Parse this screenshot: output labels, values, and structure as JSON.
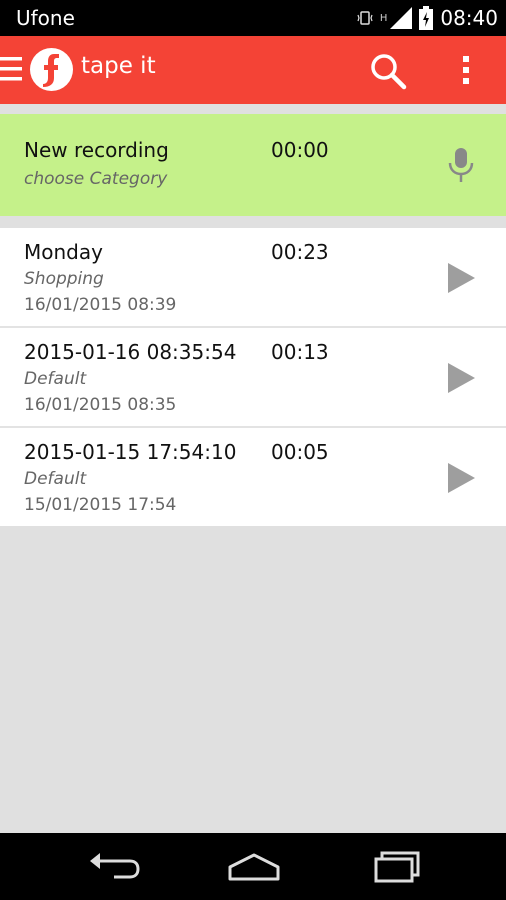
{
  "status_bar": {
    "carrier": "Ufone",
    "network_type": "H",
    "time": "08:40"
  },
  "app_bar": {
    "title": "tape it",
    "background_color": "#f44336",
    "icons": [
      "menu-icon",
      "tape-it-logo",
      "search-icon",
      "overflow-menu-icon"
    ]
  },
  "new_recording": {
    "title": "New recording",
    "duration": "00:00",
    "category": "choose Category",
    "background_color": "#c5f18a",
    "icon": "microphone-icon"
  },
  "recordings": [
    {
      "title": "Monday",
      "duration": "00:23",
      "category": "Shopping",
      "date": "16/01/2015 08:39"
    },
    {
      "title": "2015-01-16 08:35:54",
      "duration": "00:13",
      "category": "Default",
      "date": "16/01/2015 08:35"
    },
    {
      "title": "2015-01-15 17:54:10",
      "duration": "00:05",
      "category": "Default",
      "date": "15/01/2015 17:54"
    }
  ],
  "nav_bar": {
    "icons": [
      "back-icon",
      "home-icon",
      "recent-apps-icon"
    ]
  }
}
